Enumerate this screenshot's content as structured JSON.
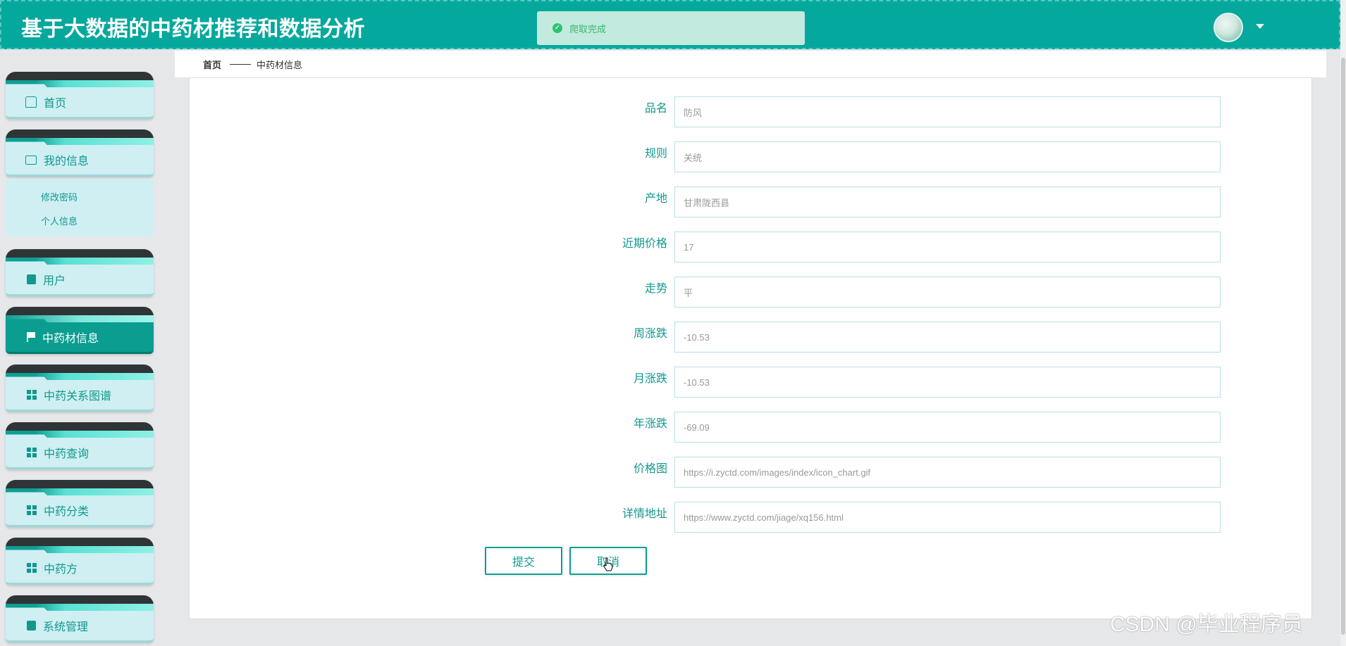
{
  "app": {
    "title": "基于大数据的中药材推荐和数据分析"
  },
  "toast": {
    "message": "爬取完成",
    "color": "#3bb46f"
  },
  "user": {
    "avatar_icon": "user-avatar"
  },
  "sidebar": {
    "items": [
      {
        "label": "首页",
        "icon": "home-icon"
      },
      {
        "label": "我的信息",
        "icon": "id-card-icon"
      },
      {
        "label": "用户",
        "icon": "clipboard-icon"
      },
      {
        "label": "中药材信息",
        "icon": "flag-icon",
        "active": true
      },
      {
        "label": "中药关系图谱",
        "icon": "grid-icon"
      },
      {
        "label": "中药查询",
        "icon": "grid-icon"
      },
      {
        "label": "中药分类",
        "icon": "grid-icon"
      },
      {
        "label": "中药方",
        "icon": "grid-icon"
      },
      {
        "label": "系统管理",
        "icon": "clipboard-icon"
      }
    ],
    "submenu": [
      "修改密码",
      "个人信息"
    ]
  },
  "breadcrumb": {
    "home": "首页",
    "current": "中药材信息"
  },
  "form": {
    "fields": [
      {
        "label": "品名",
        "value": "防风"
      },
      {
        "label": "规则",
        "value": "关统"
      },
      {
        "label": "产地",
        "value": "甘肃陇西县"
      },
      {
        "label": "近期价格",
        "value": "17"
      },
      {
        "label": "走势",
        "value": "平"
      },
      {
        "label": "周涨跌",
        "value": "-10.53"
      },
      {
        "label": "月涨跌",
        "value": "-10.53"
      },
      {
        "label": "年涨跌",
        "value": "-69.09"
      },
      {
        "label": "价格图",
        "value": "https://i.zyctd.com/images/index/icon_chart.gif"
      },
      {
        "label": "详情地址",
        "value": "https://www.zyctd.com/jiage/xq156.html"
      }
    ],
    "submit_label": "提交",
    "cancel_label": "取消"
  },
  "watermark": "CSDN @毕业程序员",
  "colors": {
    "header": "#05a89c",
    "accent": "#12988d",
    "active_menu": "#0a9d90"
  }
}
